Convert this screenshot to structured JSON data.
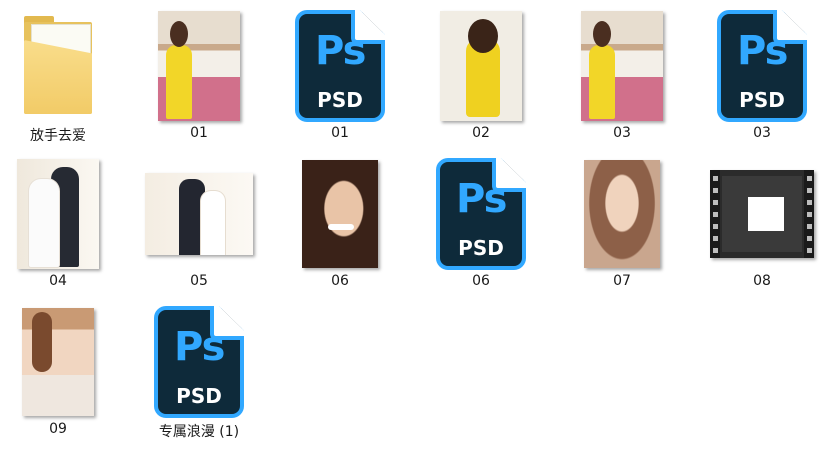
{
  "items": [
    {
      "label": "放手去爱",
      "kind": "folder",
      "thumb_icon": "folder-icon"
    },
    {
      "label": "01",
      "kind": "photo",
      "thumb_icon": "image-thumbnail"
    },
    {
      "label": "01",
      "kind": "psd",
      "thumb_icon": "psd-file-icon",
      "ps_text": "Ps",
      "ext_text": "PSD"
    },
    {
      "label": "02",
      "kind": "photo",
      "thumb_icon": "image-thumbnail"
    },
    {
      "label": "03",
      "kind": "photo",
      "thumb_icon": "image-thumbnail"
    },
    {
      "label": "03",
      "kind": "psd",
      "thumb_icon": "psd-file-icon",
      "ps_text": "Ps",
      "ext_text": "PSD"
    },
    {
      "label": "04",
      "kind": "photo",
      "thumb_icon": "image-thumbnail"
    },
    {
      "label": "05",
      "kind": "photo",
      "thumb_icon": "image-thumbnail"
    },
    {
      "label": "06",
      "kind": "photo",
      "thumb_icon": "image-thumbnail"
    },
    {
      "label": "06",
      "kind": "psd",
      "thumb_icon": "psd-file-icon",
      "ps_text": "Ps",
      "ext_text": "PSD"
    },
    {
      "label": "07",
      "kind": "photo",
      "thumb_icon": "image-thumbnail"
    },
    {
      "label": "08",
      "kind": "video",
      "thumb_icon": "video-thumbnail"
    },
    {
      "label": "09",
      "kind": "photo",
      "thumb_icon": "image-thumbnail"
    },
    {
      "label": "专属浪漫 (1)",
      "kind": "psd",
      "thumb_icon": "psd-file-icon",
      "ps_text": "Ps",
      "ext_text": "PSD"
    }
  ],
  "colors": {
    "psd_blue": "#31a8ff",
    "psd_dark": "#0e2a3a",
    "folder_yellow": "#f2cb67"
  }
}
